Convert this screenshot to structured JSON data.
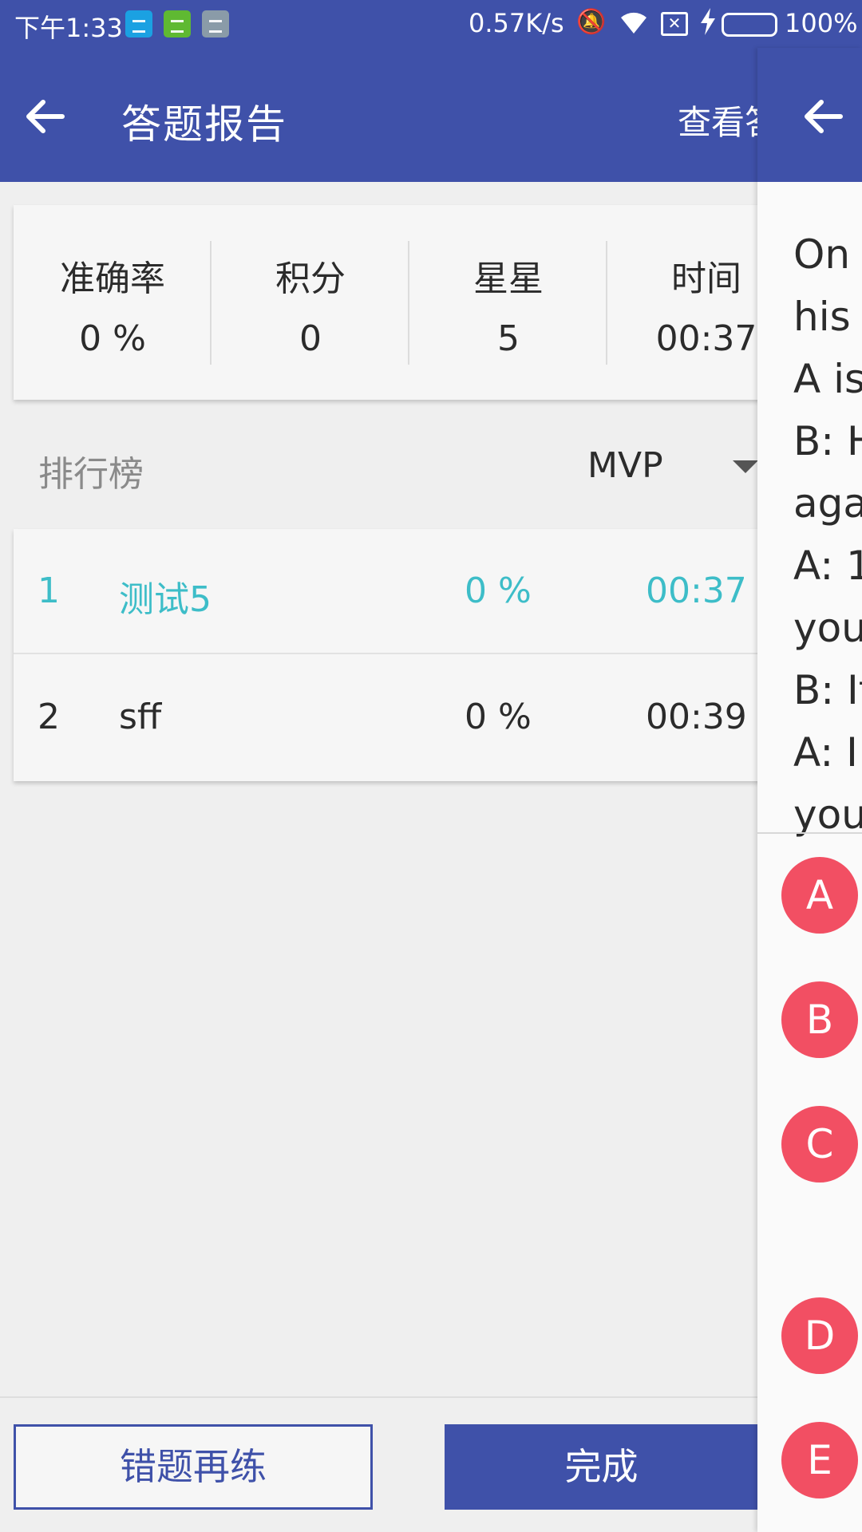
{
  "status_bar": {
    "time": "下午1:33",
    "net_speed": "0.57K/s",
    "battery_pct": "100%",
    "battery_level": 1.0,
    "icons": [
      "usb-icon",
      "android-icon",
      "message-icon",
      "mute-icon",
      "wifi-icon",
      "sim-icon",
      "charging-icon",
      "battery-icon"
    ]
  },
  "app_bar": {
    "title": "答题报告",
    "action": "查看答"
  },
  "stats": [
    {
      "label": "准确率",
      "value": "0 %"
    },
    {
      "label": "积分",
      "value": "0"
    },
    {
      "label": "星星",
      "value": "5"
    },
    {
      "label": "时间",
      "value": "00:37"
    }
  ],
  "ranking": {
    "title": "排行榜",
    "selected": "MVP",
    "rows": [
      {
        "rank": "1",
        "name": "测试5",
        "accuracy": "0 %",
        "time": "00:37",
        "highlight": "#3dbdc8"
      },
      {
        "rank": "2",
        "name": "sff",
        "accuracy": "0 %",
        "time": "00:39"
      }
    ]
  },
  "buttons": {
    "retry": "错题再练",
    "done": "完成"
  },
  "panel": {
    "passage_lines": [
      "On a",
      "his t",
      "A is",
      "B: H",
      "aga",
      "A: 1",
      "you",
      "B: It",
      "A: I",
      "you"
    ],
    "options": [
      "A",
      "B",
      "C",
      "D",
      "E"
    ]
  },
  "colors": {
    "primary": "#3f51a9",
    "accent_teal": "#3dbdc8",
    "option_red": "#f24f63"
  }
}
